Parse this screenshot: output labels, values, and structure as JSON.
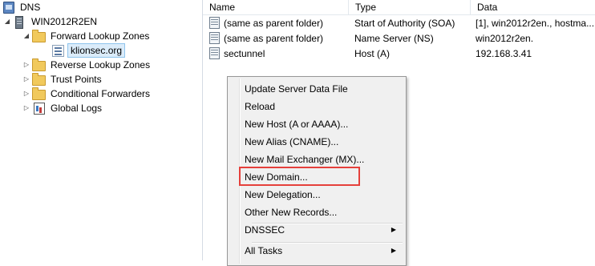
{
  "tree": {
    "root": "DNS",
    "server": "WIN2012R2EN",
    "forward_zones": "Forward Lookup Zones",
    "zone_selected": "klionsec.org",
    "reverse_zones": "Reverse Lookup Zones",
    "trust_points": "Trust Points",
    "conditional_forwarders": "Conditional Forwarders",
    "global_logs": "Global Logs"
  },
  "list": {
    "columns": [
      "Name",
      "Type",
      "Data"
    ],
    "rows": [
      {
        "name": "(same as parent folder)",
        "type": "Start of Authority (SOA)",
        "data": "[1], win2012r2en., hostma..."
      },
      {
        "name": "(same as parent folder)",
        "type": "Name Server (NS)",
        "data": "win2012r2en."
      },
      {
        "name": "sectunnel",
        "type": "Host (A)",
        "data": "192.168.3.41"
      }
    ]
  },
  "context_menu": {
    "items": [
      "Update Server Data File",
      "Reload",
      "New Host (A or AAAA)...",
      "New Alias (CNAME)...",
      "New Mail Exchanger (MX)...",
      "New Domain...",
      "New Delegation...",
      "Other New Records...",
      "DNSSEC",
      "All Tasks"
    ],
    "highlighted": "New Domain...",
    "highlight_color": "#e5403b"
  }
}
